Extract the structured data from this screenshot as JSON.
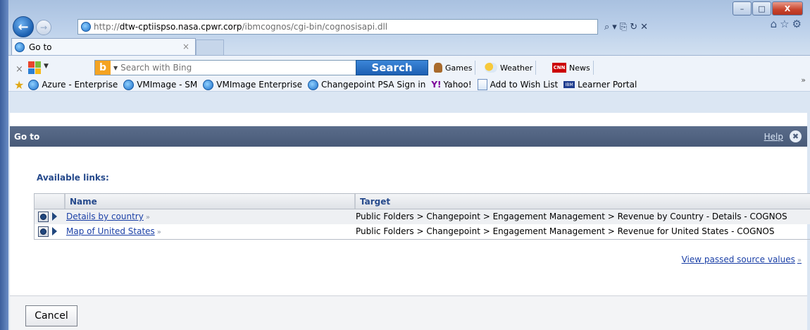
{
  "window": {
    "controls": {
      "minimize": "–",
      "maximize": "□",
      "close": "X"
    }
  },
  "nav": {
    "back_symbol": "←",
    "forward_symbol": "→",
    "url_prefix": "http://",
    "url_host": "dtw-cptiispso.nasa.cpwr.corp",
    "url_path": "/ibmcognos/cgi-bin/cognosisapi.dll",
    "addr_tools": [
      "⌕",
      "▾",
      "⎘",
      "↻",
      "✕"
    ],
    "fav_tools": [
      "⌂",
      "☆",
      "⚙"
    ]
  },
  "tab": {
    "label": "Go to",
    "close": "×"
  },
  "toolbar": {
    "x_label": "×",
    "search_placeholder": "Search with Bing",
    "bing_letter": "b",
    "search_button": "Search",
    "games": "Games",
    "weather": "Weather",
    "cnn_logo": "CNN",
    "news": "News"
  },
  "favorites": {
    "items": [
      {
        "label": "Azure - Enterprise",
        "icon": "ie-icon"
      },
      {
        "label": "VMImage - SM",
        "icon": "ie-icon"
      },
      {
        "label": "VMImage Enterprise",
        "icon": "ie-icon"
      },
      {
        "label": "Changepoint PSA Sign in",
        "icon": "ie-icon"
      },
      {
        "label": "Yahoo!",
        "icon": "yahoo-icon"
      },
      {
        "label": "Add to Wish List",
        "icon": "page-icon"
      },
      {
        "label": "Learner Portal",
        "icon": "ibm-icon"
      }
    ],
    "more": "»"
  },
  "dialog": {
    "title": "Go to",
    "help": "Help",
    "close_symbol": "✖",
    "available_label": "Available links:",
    "columns": {
      "name": "Name",
      "target": "Target"
    },
    "rows": [
      {
        "name": "Details by country",
        "target": "Public Folders > Changepoint > Engagement Management > Revenue by Country - Details - COGNOS"
      },
      {
        "name": "Map of United States",
        "target": "Public Folders > Changepoint > Engagement Management > Revenue for United States - COGNOS"
      }
    ],
    "chevron": "»",
    "view_passed": "View passed source values",
    "cancel": "Cancel"
  },
  "colors": {
    "header_bg": "#485a78",
    "link": "#1a3fa6",
    "label_blue": "#264a8c"
  }
}
